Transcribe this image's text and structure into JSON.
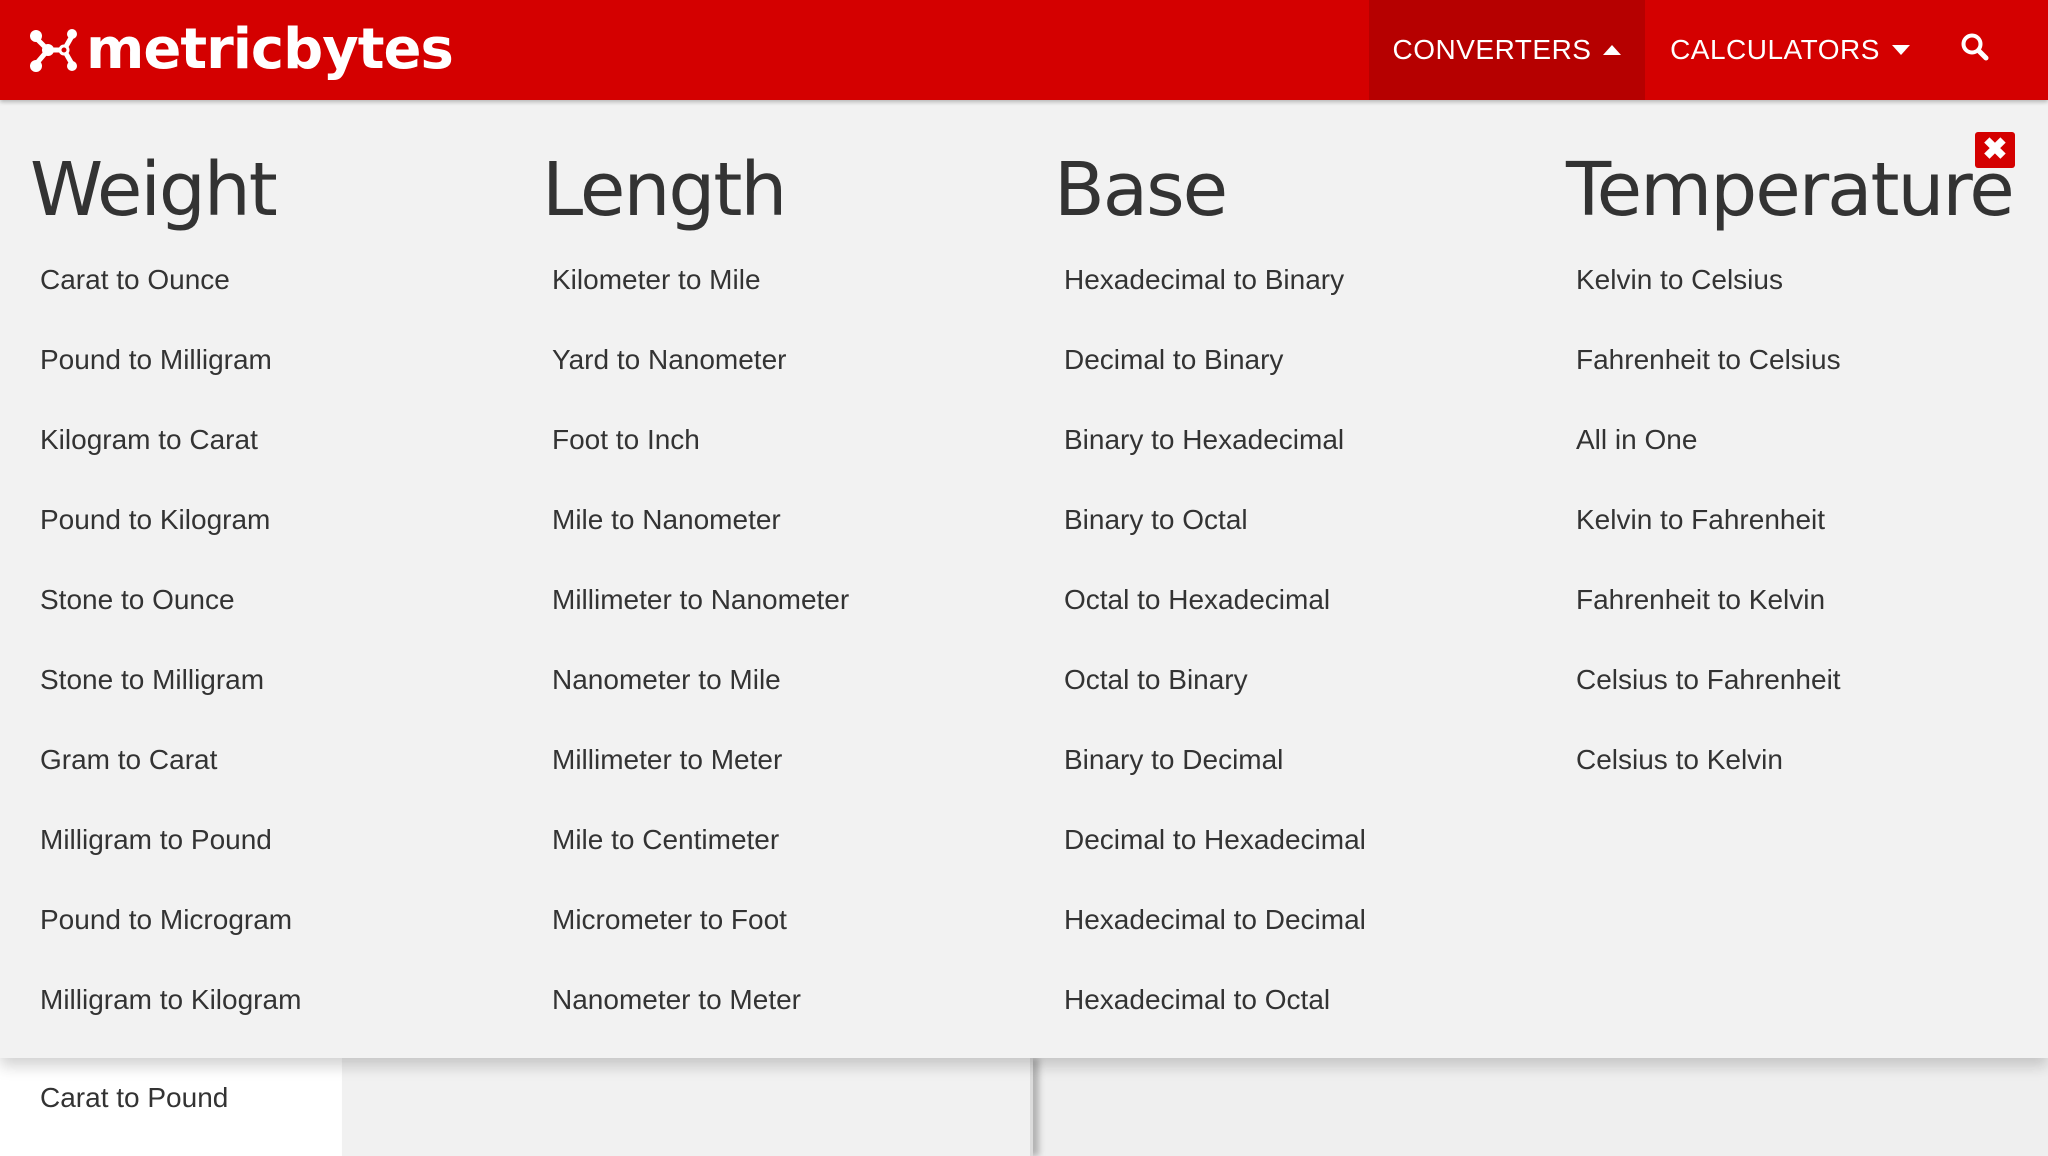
{
  "header": {
    "logo_text": "metricbytes",
    "nav": [
      {
        "label": "CONVERTERS"
      },
      {
        "label": "CALCULATORS"
      }
    ]
  },
  "colors": {
    "brand_red": "#d40000",
    "active_nav_red": "#b60000",
    "text_dark": "#333333",
    "panel_bg": "#f2f2f2"
  },
  "icons": {
    "logo_mark": "molecule-icon",
    "converters_caret": "caret-up-icon",
    "calculators_caret": "caret-down-icon",
    "search": "search-icon",
    "close": "close-icon"
  },
  "mega_menu": {
    "close_symbol": "✖",
    "columns": [
      {
        "title": "Weight",
        "items": [
          "Carat to Ounce",
          "Pound to Milligram",
          "Kilogram to Carat",
          "Pound to Kilogram",
          "Stone to Ounce",
          "Stone to Milligram",
          "Gram to Carat",
          "Milligram to Pound",
          "Pound to Microgram",
          "Milligram to Kilogram"
        ]
      },
      {
        "title": "Length",
        "items": [
          "Kilometer to Mile",
          "Yard to Nanometer",
          "Foot to Inch",
          "Mile to Nanometer",
          "Millimeter to Nanometer",
          "Nanometer to Mile",
          "Millimeter to Meter",
          "Mile to Centimeter",
          "Micrometer to Foot",
          "Nanometer to Meter"
        ]
      },
      {
        "title": "Base",
        "items": [
          "Hexadecimal to Binary",
          "Decimal to Binary",
          "Binary to Hexadecimal",
          "Binary to Octal",
          "Octal to Hexadecimal",
          "Octal to Binary",
          "Binary to Decimal",
          "Decimal to Hexadecimal",
          "Hexadecimal to Decimal",
          "Hexadecimal to Octal"
        ]
      },
      {
        "title": "Temperature",
        "items": [
          "Kelvin to Celsius",
          "Fahrenheit to Celsius",
          "All in One",
          "Kelvin to Fahrenheit",
          "Fahrenheit to Kelvin",
          "Celsius to Fahrenheit",
          "Celsius to Kelvin"
        ]
      }
    ]
  },
  "below_menu": {
    "item": "Carat to Pound"
  }
}
